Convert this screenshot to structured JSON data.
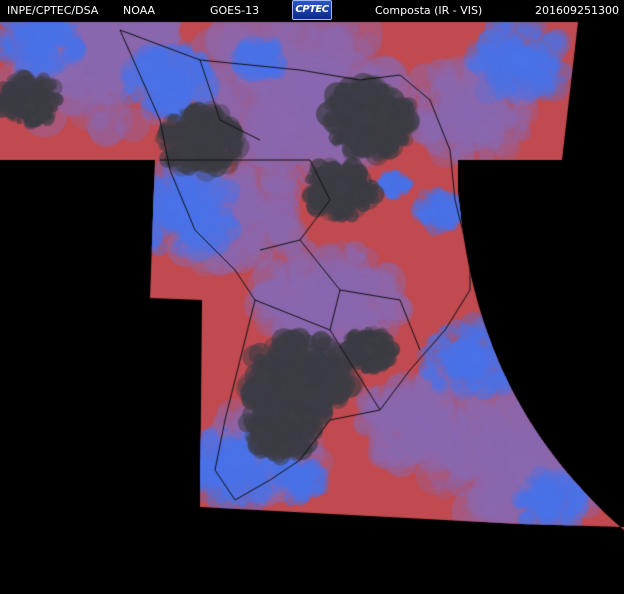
{
  "header": {
    "agency": "INPE/CPTEC/DSA",
    "noaa": "NOAA",
    "satellite": "GOES-13",
    "logo_text": "CPTEC",
    "product": "Composta (IR - VIS)",
    "timestamp": "201609251300"
  },
  "map": {
    "region": "South America",
    "colors": {
      "land_clear": "#c84b4b",
      "ocean_clear": "#c04a50",
      "clouds_cold": "#4a72e8",
      "clouds_mixed": "#8a68b0",
      "cloud_dark": "#3c3c44",
      "background": "#000000",
      "borders": "#111111"
    }
  }
}
